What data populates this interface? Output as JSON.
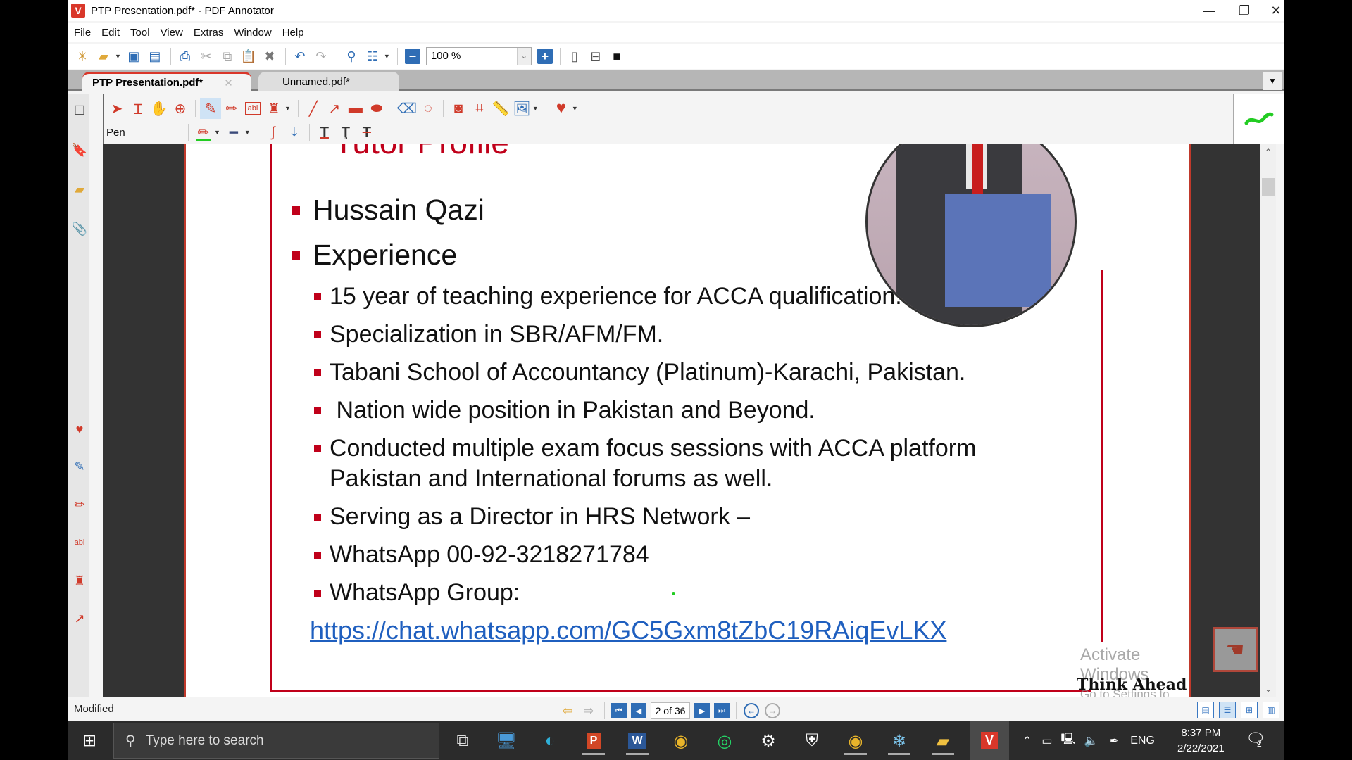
{
  "window": {
    "title": "PTP Presentation.pdf* - PDF Annotator",
    "controls": {
      "minimize": "—",
      "restore": "❐",
      "close": "✕"
    }
  },
  "menu": [
    "File",
    "Edit",
    "Tool",
    "View",
    "Extras",
    "Window",
    "Help"
  ],
  "toolbar": {
    "icons": [
      "new-document",
      "open-folder",
      "save",
      "save-as",
      "print",
      "cut",
      "copy",
      "paste",
      "delete",
      "undo",
      "redo",
      "find",
      "thumbnails"
    ],
    "zoom_value": "100 %"
  },
  "tabs": [
    {
      "label": "PTP Presentation.pdf*",
      "active": true
    },
    {
      "label": "Unnamed.pdf*",
      "active": false
    }
  ],
  "annotation_toolbar": {
    "tools_row1": [
      "select-arrow",
      "text-select",
      "hand",
      "zoom-in",
      "pen",
      "highlighter",
      "text-box",
      "stamp",
      "line",
      "arrow",
      "rectangle",
      "ellipse",
      "eraser",
      "lasso",
      "snapshot",
      "crop",
      "ruler",
      "insert-image",
      "favorites"
    ],
    "active_tool": "pen",
    "tool_label": "Pen",
    "pen_color": "#22cc22",
    "tools_row2": [
      "pen-color",
      "line-width",
      "smooth-curve",
      "snap",
      "text-underline",
      "text-squiggly",
      "text-strikeout"
    ]
  },
  "sidebar_icons": [
    "blank-page",
    "bookmark",
    "sticky-note",
    "attachment",
    "favorites-heart",
    "pen",
    "highlighter",
    "text-box",
    "stamp",
    "arrow"
  ],
  "slide": {
    "title": "Tutor Profile",
    "name": "Hussain Qazi",
    "section": "Experience",
    "bullets": [
      "15 year of teaching experience for ACCA qualification.",
      "Specialization in SBR/AFM/FM.",
      "Tabani School of Accountancy (Platinum)-Karachi, Pakistan.",
      " Nation wide position in Pakistan and Beyond.",
      "Conducted multiple exam focus sessions with ACCA platform Pakistan and International forums as well.",
      "Serving as a Director in HRS Network –",
      "WhatsApp 00-92-3218271784",
      "WhatsApp Group:"
    ],
    "link": "https://chat.whatsapp.com/GC5Gxm8tZbC19RAiqEvLKX",
    "footer": "Think Ahead",
    "accent_color": "#c0001a"
  },
  "watermark": {
    "line1": "Activate Windows",
    "line2": "Go to Settings to activate Windows."
  },
  "statusbar": {
    "status": "Modified",
    "page_indicator": "2 of 36",
    "current_page": 2,
    "total_pages": 36
  },
  "taskbar": {
    "search_placeholder": "Type here to search",
    "apps": [
      "task-view",
      "remote-desktop",
      "edge",
      "powerpoint",
      "word",
      "chrome",
      "whatsapp",
      "settings",
      "security",
      "chrome-2",
      "snowflake-app",
      "file-explorer",
      "pdf-annotator"
    ],
    "language": "ENG",
    "time": "8:37 PM",
    "date": "2/22/2021",
    "notifications": "2"
  }
}
